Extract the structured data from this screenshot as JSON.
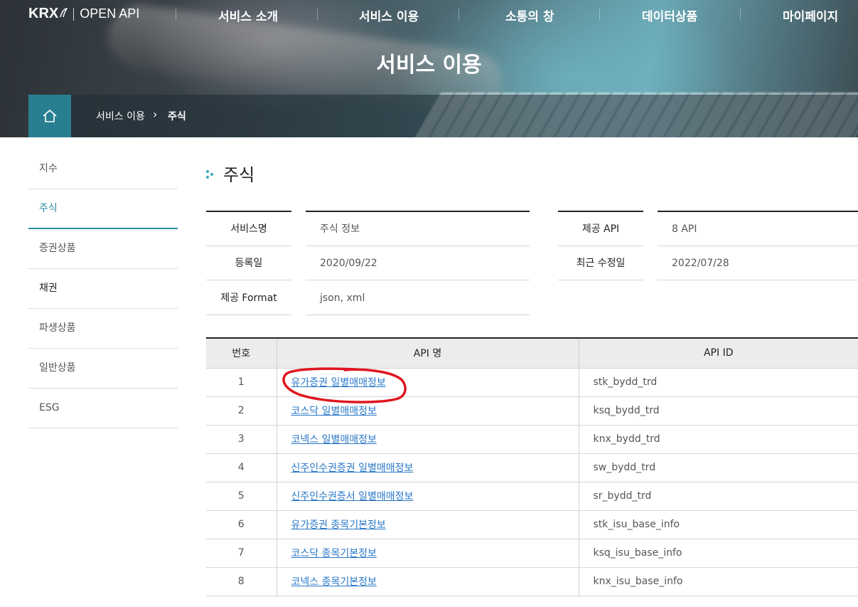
{
  "header": {
    "logo": "KRX",
    "product": "OPEN API",
    "nav": [
      "서비스 소개",
      "서비스 이용",
      "소통의 창",
      "데이터상품",
      "마이페이지"
    ],
    "hero_title": "서비스 이용",
    "breadcrumb": [
      "서비스 이용",
      "주식"
    ]
  },
  "sidebar": {
    "items": [
      "지수",
      "주식",
      "증권상품",
      "채권",
      "파생상품",
      "일반상품",
      "ESG"
    ],
    "active": "주식"
  },
  "main": {
    "title": "주식",
    "info": {
      "service_name_label": "서비스명",
      "service_name": "주식 정보",
      "api_count_label": "제공 API",
      "api_count": "8 API",
      "registered_label": "등록일",
      "registered": "2020/09/22",
      "modified_label": "최근 수정일",
      "modified": "2022/07/28",
      "format_label": "제공 Format",
      "format": "json, xml"
    },
    "table": {
      "headers": [
        "번호",
        "API 명",
        "API ID"
      ],
      "rows": [
        {
          "num": "1",
          "name": "유가증권 일별매매정보",
          "id": "stk_bydd_trd"
        },
        {
          "num": "2",
          "name": "코스닥 일별매매정보",
          "id": "ksq_bydd_trd"
        },
        {
          "num": "3",
          "name": "코넥스 일별매매정보",
          "id": "knx_bydd_trd"
        },
        {
          "num": "4",
          "name": "신주인수권증권 일별매매정보",
          "id": "sw_bydd_trd"
        },
        {
          "num": "5",
          "name": "신주인수권증서 일별매매정보",
          "id": "sr_bydd_trd"
        },
        {
          "num": "6",
          "name": "유가증권 종목기본정보",
          "id": "stk_isu_base_info"
        },
        {
          "num": "7",
          "name": "코스닥 종목기본정보",
          "id": "ksq_isu_base_info"
        },
        {
          "num": "8",
          "name": "코넥스 종목기본정보",
          "id": "knx_isu_base_info"
        }
      ]
    }
  },
  "colors": {
    "accent": "#2a8ea3",
    "link": "#2a78c8",
    "annotation": "#e0161f"
  }
}
